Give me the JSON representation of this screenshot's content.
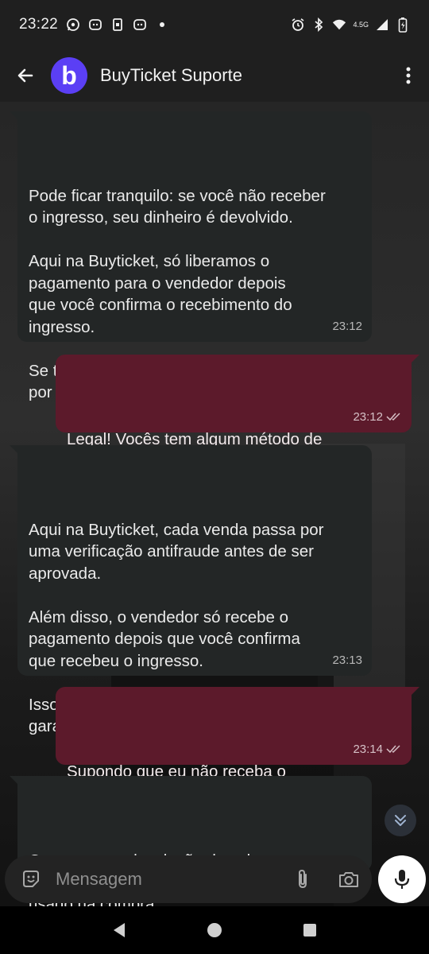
{
  "status_bar": {
    "time": "23:22",
    "network": "4.5G",
    "icons": [
      "whatsapp-icon",
      "message-icon",
      "sim-toolkit-icon",
      "message-icon",
      "dot-icon",
      "alarm-icon",
      "bluetooth-icon",
      "wifi-icon",
      "signal-icon",
      "battery-icon"
    ]
  },
  "header": {
    "back_icon": "arrow-left-icon",
    "avatar_letter": "b",
    "title": "BuyTicket Suporte",
    "menu_icon": "more-vertical-icon"
  },
  "colors": {
    "avatar": "#5b3ff5",
    "incoming_bubble": "#232626",
    "outgoing_bubble": "#5c1a2b",
    "header": "#1f1f1f"
  },
  "messages": [
    {
      "direction": "incoming",
      "text": "Pode ficar tranquilo: se você não receber\no ingresso, seu dinheiro é devolvido.\n\nAqui na Buyticket, só liberamos o\npagamento para o vendedor depois\nque você confirma o recebimento do\ningresso.\n\nSe tiver qualquer problema, é só avisar\npor aqui que a gente resolve!",
      "time": "23:12"
    },
    {
      "direction": "outgoing",
      "text": "Legal! Vocês tem algum método de\nmonitorar o vendedor pra saber se não\né um golpista",
      "time": "23:12",
      "status": "read"
    },
    {
      "direction": "incoming",
      "text": "Aqui na Buyticket, cada venda passa por\numa verificação antifraude antes de ser\naprovada.\n\nAlém disso, o vendedor só recebe o\npagamento depois que você confirma\nque recebeu o ingresso.\n\nIsso reduz muito o risco de golpe e\ngarante mais segurança pra você!",
      "time": "23:13"
    },
    {
      "direction": "outgoing",
      "text": "Supondo que eu não receba o\ningresso, qual o prazo para estorno do\npagamento?",
      "time": "23:14",
      "status": "read"
    },
    {
      "direction": "incoming",
      "text": "O prazo para devolução do valor\ndepende do método de pagamento\nusado na compra.",
      "time": ""
    }
  ],
  "composer": {
    "placeholder": "Mensagem",
    "emoji_icon": "emoji-icon",
    "attach_icon": "paperclip-icon",
    "camera_icon": "camera-icon",
    "mic_icon": "microphone-icon",
    "scroll_icon": "chevron-double-down-icon"
  },
  "nav_bar": {
    "back_icon": "triangle-back-icon",
    "home_icon": "circle-home-icon",
    "recents_icon": "square-recents-icon"
  }
}
